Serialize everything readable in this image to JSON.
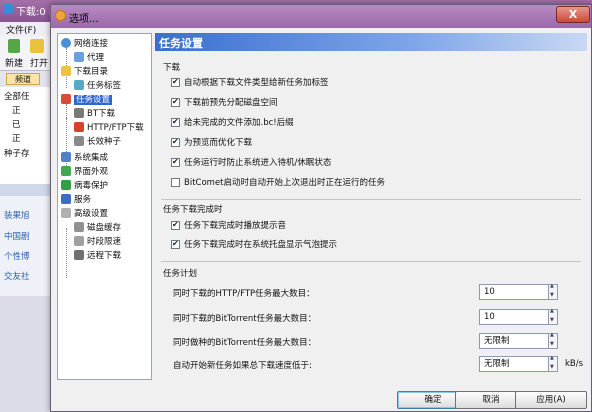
{
  "background_window": {
    "title": "下载:0 L",
    "menu": "文件(F)",
    "toolbar": [
      "新建",
      "打开"
    ],
    "tab": "频道",
    "tree": [
      "全部任",
      "正",
      "已",
      "正",
      "种子存"
    ],
    "links": [
      "装果旭",
      "中国剧",
      "个性博",
      "交友社"
    ]
  },
  "dialog": {
    "title": "选项...",
    "close_label": "X",
    "nav": [
      {
        "label": "网络连接",
        "icon": "globe-icon"
      },
      {
        "label": "代理",
        "icon": "proxy-icon"
      },
      {
        "label": "下载目录",
        "icon": "folder-icon"
      },
      {
        "label": "任务标签",
        "icon": "tag-icon"
      },
      {
        "label": "任务设置",
        "icon": "task-settings-icon",
        "selected": true
      },
      {
        "label": "BT下载",
        "icon": "bt-icon"
      },
      {
        "label": "HTTP/FTP下载",
        "icon": "http-icon"
      },
      {
        "label": "长效种子",
        "icon": "seed-icon"
      },
      {
        "label": "系统集成",
        "icon": "system-icon"
      },
      {
        "label": "界面外观",
        "icon": "appearance-icon"
      },
      {
        "label": "病毒保护",
        "icon": "virus-icon"
      },
      {
        "label": "服务",
        "icon": "service-icon"
      },
      {
        "label": "高级设置",
        "icon": "advanced-icon"
      },
      {
        "label": "磁盘缓存",
        "icon": "disk-cache-icon"
      },
      {
        "label": "时段限速",
        "icon": "speed-limit-icon"
      },
      {
        "label": "远程下载",
        "icon": "remote-icon"
      }
    ],
    "panel_title": "任务设置",
    "group_download": {
      "title": "下载",
      "options": [
        {
          "label": "自动根据下载文件类型给新任务加标签",
          "checked": true
        },
        {
          "label": "下载前预先分配磁盘空间",
          "checked": true
        },
        {
          "label": "给未完成的文件添加.bc!后缀",
          "checked": true
        },
        {
          "label": "为预览而优化下载",
          "checked": true
        },
        {
          "label": "任务运行时防止系统进入待机/休眠状态",
          "checked": true
        },
        {
          "label": "BitComet启动时自动开始上次退出时正在运行的任务",
          "checked": false
        }
      ]
    },
    "group_complete": {
      "title": "任务下载完成时",
      "options": [
        {
          "label": "任务下载完成时播放提示音",
          "checked": true
        },
        {
          "label": "任务下载完成时在系统托盘显示气泡提示",
          "checked": true
        }
      ]
    },
    "group_plan": {
      "title": "任务计划",
      "fields": [
        {
          "label": "同时下载的HTTP/FTP任务最大数目：",
          "value": "10"
        },
        {
          "label": "同时下载的BitTorrent任务最大数目：",
          "value": "10"
        },
        {
          "label": "同时做种的BitTorrent任务最大数目：",
          "value": "无限制"
        },
        {
          "label": "自动开始新任务如果总下载速度低于:",
          "value": "无限制",
          "unit": "kB/s"
        }
      ]
    },
    "buttons": {
      "ok": "确定",
      "cancel": "取消",
      "apply": "应用(A)"
    }
  }
}
